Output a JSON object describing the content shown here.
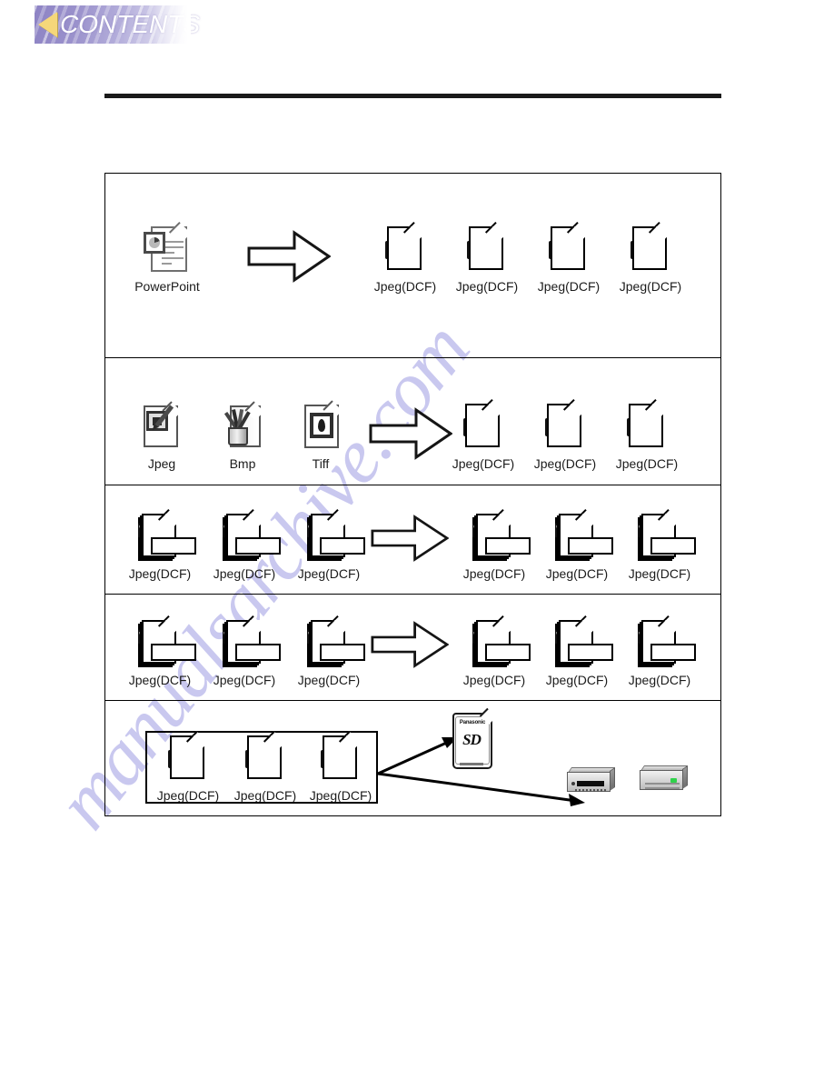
{
  "banner": {
    "label": "CONTENTS",
    "triangle_icon": "left-triangle-icon",
    "gradient_from": "#8d83c4",
    "gradient_to": "#efeef8",
    "triangle_color": "#f5d77a",
    "text_color": "#ffffff"
  },
  "watermark": {
    "text": "manualsarchive.com",
    "color": "#c9c8ef"
  },
  "rule": {
    "color": "#1a1a1a"
  },
  "diagram": {
    "border_color": "#000000",
    "rows": [
      {
        "id": "row-powerpoint-to-jpeg",
        "sources": [
          {
            "icon": "powerpoint-file-icon",
            "label": "PowerPoint"
          }
        ],
        "arrow": "right-arrow-icon",
        "targets": [
          {
            "icon": "jpeg-dcf-file-icon",
            "label": "Jpeg(DCF)"
          },
          {
            "icon": "jpeg-dcf-file-icon",
            "label": "Jpeg(DCF)"
          },
          {
            "icon": "jpeg-dcf-file-icon",
            "label": "Jpeg(DCF)"
          },
          {
            "icon": "jpeg-dcf-file-icon",
            "label": "Jpeg(DCF)"
          }
        ]
      },
      {
        "id": "row-image-formats-to-jpeg",
        "sources": [
          {
            "icon": "jpeg-file-icon",
            "label": "Jpeg"
          },
          {
            "icon": "bmp-file-icon",
            "label": "Bmp"
          },
          {
            "icon": "tiff-file-icon",
            "label": "Tiff"
          }
        ],
        "arrow": "right-arrow-icon",
        "targets": [
          {
            "icon": "jpeg-dcf-file-icon",
            "label": "Jpeg(DCF)"
          },
          {
            "icon": "jpeg-dcf-file-icon",
            "label": "Jpeg(DCF)"
          },
          {
            "icon": "jpeg-dcf-file-icon",
            "label": "Jpeg(DCF)"
          }
        ]
      },
      {
        "id": "row-jpeg-rename-a",
        "sources": [
          {
            "icon": "jpeg-dcf-stacked-file-icon",
            "label": "Jpeg(DCF)"
          },
          {
            "icon": "jpeg-dcf-stacked-file-icon",
            "label": "Jpeg(DCF)"
          },
          {
            "icon": "jpeg-dcf-stacked-file-icon",
            "label": "Jpeg(DCF)"
          }
        ],
        "arrow": "right-arrow-icon",
        "targets": [
          {
            "icon": "jpeg-dcf-stacked-file-icon",
            "label": "Jpeg(DCF)"
          },
          {
            "icon": "jpeg-dcf-stacked-file-icon",
            "label": "Jpeg(DCF)"
          },
          {
            "icon": "jpeg-dcf-stacked-file-icon",
            "label": "Jpeg(DCF)"
          }
        ]
      },
      {
        "id": "row-jpeg-rename-b",
        "sources": [
          {
            "icon": "jpeg-dcf-stacked-file-icon",
            "label": "Jpeg(DCF)"
          },
          {
            "icon": "jpeg-dcf-stacked-file-icon",
            "label": "Jpeg(DCF)"
          },
          {
            "icon": "jpeg-dcf-stacked-file-icon",
            "label": "Jpeg(DCF)"
          }
        ],
        "arrow": "right-arrow-icon",
        "targets": [
          {
            "icon": "jpeg-dcf-stacked-file-icon",
            "label": "Jpeg(DCF)"
          },
          {
            "icon": "jpeg-dcf-stacked-file-icon",
            "label": "Jpeg(DCF)"
          },
          {
            "icon": "jpeg-dcf-stacked-file-icon",
            "label": "Jpeg(DCF)"
          }
        ]
      },
      {
        "id": "row-copy-to-sd-card",
        "group": [
          {
            "icon": "jpeg-dcf-file-icon",
            "label": "Jpeg(DCF)"
          },
          {
            "icon": "jpeg-dcf-file-icon",
            "label": "Jpeg(DCF)"
          },
          {
            "icon": "jpeg-dcf-file-icon",
            "label": "Jpeg(DCF)"
          }
        ],
        "destinations": [
          {
            "icon": "sd-card-icon",
            "brand": "Panasonic",
            "logo": "SD"
          },
          {
            "icon": "card-reader-icon"
          },
          {
            "icon": "card-drive-icon",
            "led_color": "#2fd24a"
          }
        ]
      }
    ]
  }
}
